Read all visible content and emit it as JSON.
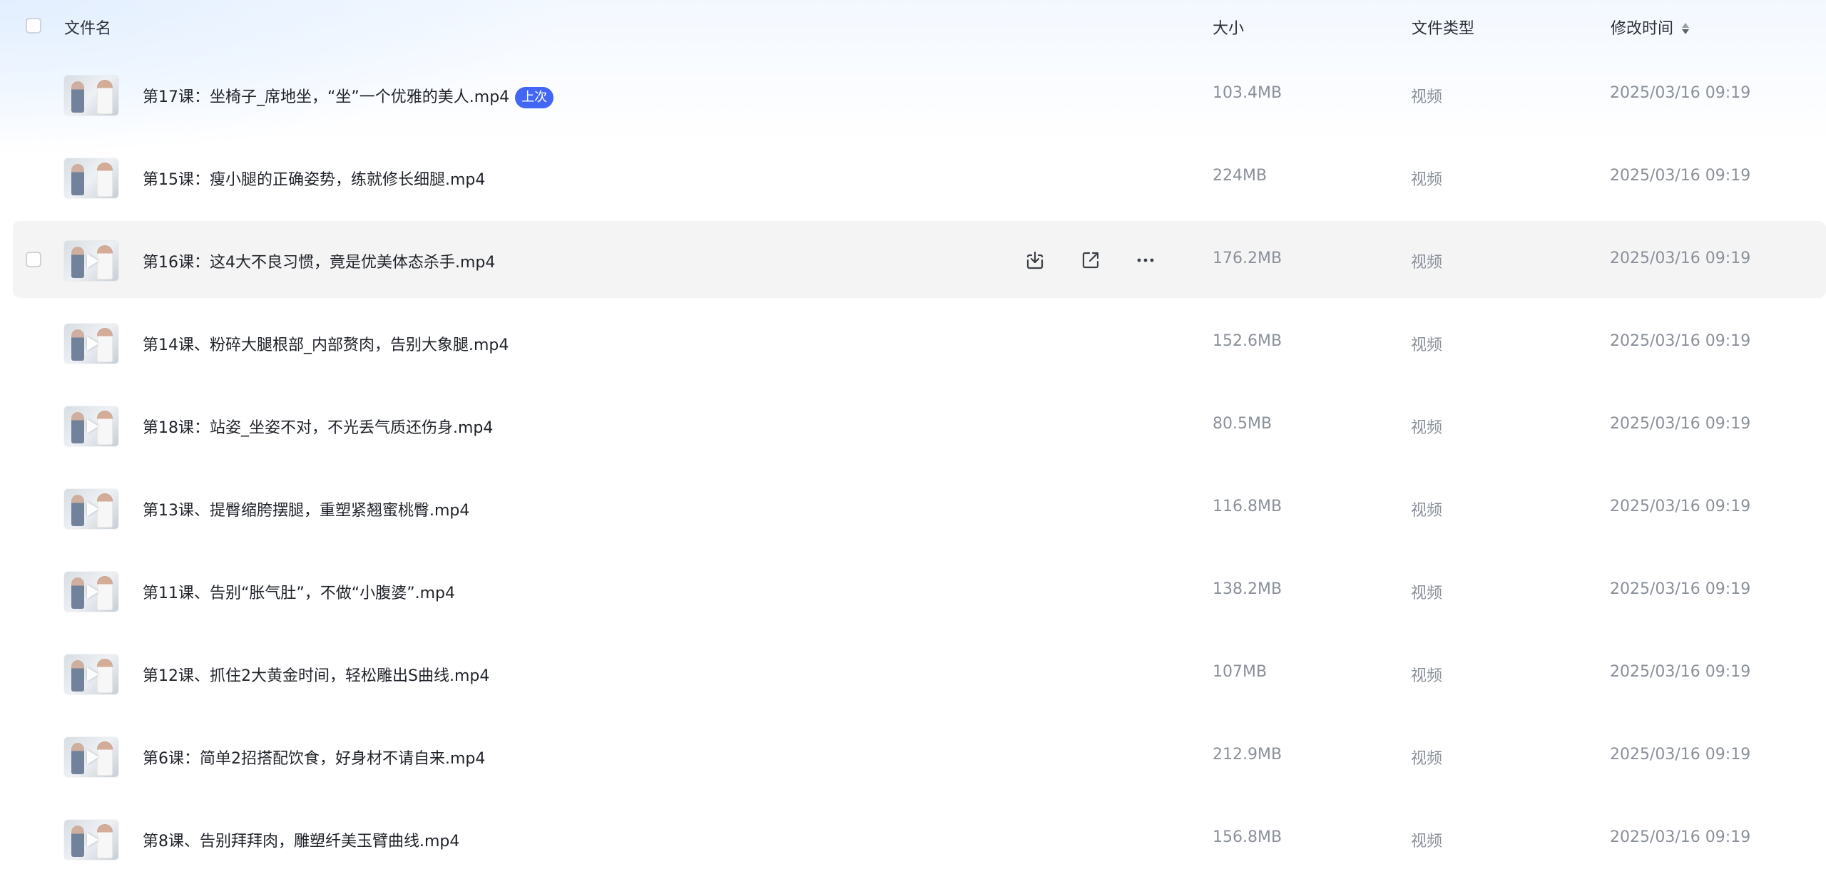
{
  "header": {
    "name": "文件名",
    "size": "大小",
    "type": "文件类型",
    "time": "修改时间"
  },
  "files": [
    {
      "name": "第17课：坐椅子_席地坐，“坐”一个优雅的美人.mp4",
      "badge": "上次",
      "size": "103.4MB",
      "type": "视频",
      "time": "2025/03/16 09:19"
    },
    {
      "name": "第15课：瘦小腿的正确姿势，练就修长细腿.mp4",
      "size": "224MB",
      "type": "视频",
      "time": "2025/03/16 09:19"
    },
    {
      "name": "第16课：这4大不良习惯，竟是优美体态杀手.mp4",
      "size": "176.2MB",
      "type": "视频",
      "time": "2025/03/16 09:19"
    },
    {
      "name": "第14课、粉碎大腿根部_内部赘肉，告别大象腿.mp4",
      "size": "152.6MB",
      "type": "视频",
      "time": "2025/03/16 09:19"
    },
    {
      "name": "第18课：站姿_坐姿不对，不光丢气质还伤身.mp4",
      "size": "80.5MB",
      "type": "视频",
      "time": "2025/03/16 09:19"
    },
    {
      "name": "第13课、提臀缩胯摆腿，重塑紧翘蜜桃臀.mp4",
      "size": "116.8MB",
      "type": "视频",
      "time": "2025/03/16 09:19"
    },
    {
      "name": "第11课、告别“胀气肚”，不做“小腹婆”.mp4",
      "size": "138.2MB",
      "type": "视频",
      "time": "2025/03/16 09:19"
    },
    {
      "name": "第12课、抓住2大黄金时间，轻松雕出S曲线.mp4",
      "size": "107MB",
      "type": "视频",
      "time": "2025/03/16 09:19"
    },
    {
      "name": "第6课：简单2招搭配饮食，好身材不请自来.mp4",
      "size": "212.9MB",
      "type": "视频",
      "time": "2025/03/16 09:19"
    },
    {
      "name": "第8课、告别拜拜肉，雕塑纤美玉臂曲线.mp4",
      "size": "156.8MB",
      "type": "视频",
      "time": "2025/03/16 09:19"
    }
  ],
  "icons": {
    "download": "download-icon",
    "share": "share-icon",
    "more": "more-icon"
  },
  "colors": {
    "badge": "#4267f4",
    "hover_row": "#f4f4f5",
    "secondary_text": "#8a9099"
  }
}
